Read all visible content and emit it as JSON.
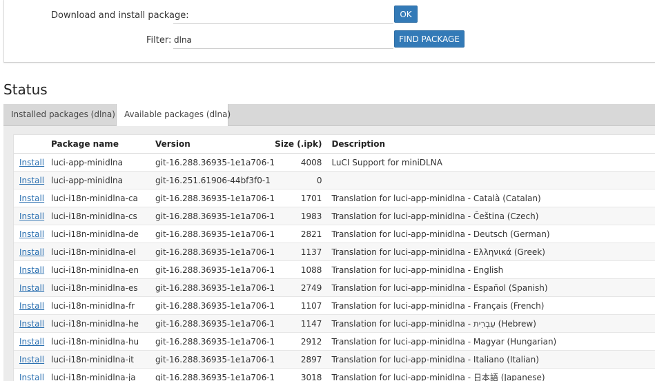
{
  "form": {
    "download_label": "Download and install package:",
    "download_value": "",
    "ok_label": "OK",
    "filter_label": "Filter:",
    "filter_value": "dlna",
    "find_label": "FIND PACKAGE"
  },
  "status": {
    "title": "Status",
    "tabs": [
      {
        "label": "Installed packages (dlna)"
      },
      {
        "label": "Available packages (dlna)"
      }
    ]
  },
  "table": {
    "headers": {
      "name": "Package name",
      "version": "Version",
      "size": "Size (.ipk)",
      "description": "Description"
    },
    "action_label": "Install",
    "rows": [
      {
        "name": "luci-app-minidlna",
        "version": "git-16.288.36935-1e1a706-1",
        "size": "4008",
        "description": "LuCI Support for miniDLNA"
      },
      {
        "name": "luci-app-minidlna",
        "version": "git-16.251.61906-44bf3f0-1",
        "size": "0",
        "description": ""
      },
      {
        "name": "luci-i18n-minidlna-ca",
        "version": "git-16.288.36935-1e1a706-1",
        "size": "1701",
        "description": "Translation for luci-app-minidlna - Català (Catalan)"
      },
      {
        "name": "luci-i18n-minidlna-cs",
        "version": "git-16.288.36935-1e1a706-1",
        "size": "1983",
        "description": "Translation for luci-app-minidlna - Čeština (Czech)"
      },
      {
        "name": "luci-i18n-minidlna-de",
        "version": "git-16.288.36935-1e1a706-1",
        "size": "2821",
        "description": "Translation for luci-app-minidlna - Deutsch (German)"
      },
      {
        "name": "luci-i18n-minidlna-el",
        "version": "git-16.288.36935-1e1a706-1",
        "size": "1137",
        "description": "Translation for luci-app-minidlna - Ελληνικά (Greek)"
      },
      {
        "name": "luci-i18n-minidlna-en",
        "version": "git-16.288.36935-1e1a706-1",
        "size": "1088",
        "description": "Translation for luci-app-minidlna - English"
      },
      {
        "name": "luci-i18n-minidlna-es",
        "version": "git-16.288.36935-1e1a706-1",
        "size": "2749",
        "description": "Translation for luci-app-minidlna - Español (Spanish)"
      },
      {
        "name": "luci-i18n-minidlna-fr",
        "version": "git-16.288.36935-1e1a706-1",
        "size": "1107",
        "description": "Translation for luci-app-minidlna - Français (French)"
      },
      {
        "name": "luci-i18n-minidlna-he",
        "version": "git-16.288.36935-1e1a706-1",
        "size": "1147",
        "description": "Translation for luci-app-minidlna - עִבְרִית (Hebrew)"
      },
      {
        "name": "luci-i18n-minidlna-hu",
        "version": "git-16.288.36935-1e1a706-1",
        "size": "2912",
        "description": "Translation for luci-app-minidlna - Magyar (Hungarian)"
      },
      {
        "name": "luci-i18n-minidlna-it",
        "version": "git-16.288.36935-1e1a706-1",
        "size": "2897",
        "description": "Translation for luci-app-minidlna - Italiano (Italian)"
      },
      {
        "name": "luci-i18n-minidlna-ja",
        "version": "git-16.288.36935-1e1a706-1",
        "size": "3018",
        "description": "Translation for luci-app-minidlna - 日本語 (Japanese)"
      }
    ]
  },
  "colors": {
    "button": "#337ab7",
    "link": "#2a6fb0",
    "tab_bar": "#d8d8d8"
  }
}
